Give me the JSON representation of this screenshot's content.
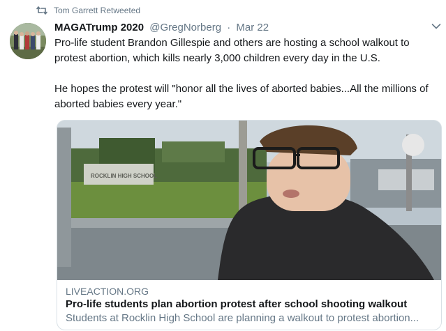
{
  "retweet": {
    "label": "Tom Garrett Retweeted",
    "icon": "retweet-icon"
  },
  "tweet": {
    "author_name": "MAGATrump 2020",
    "handle": "@GregNorberg",
    "separator": "·",
    "date": "Mar 22",
    "paragraphs": [
      "Pro-life student Brandon Gillespie and others are hosting a school walkout to protest abortion, which kills nearly 3,000 children every day in the U.S.",
      "He hopes the protest will \"honor all the lives of aborted babies...All the millions of aborted babies every year.\""
    ],
    "menu_icon": "chevron-down-icon"
  },
  "card": {
    "image_sign_text": "ROCKLIN HIGH SCHOOL",
    "domain": "LIVEACTION.ORG",
    "title": "Pro-life students plan abortion protest after school shooting walkout",
    "description": "Students at Rocklin High School are planning a walkout to protest abortion..."
  },
  "colors": {
    "text_primary": "#14171a",
    "text_secondary": "#657786",
    "card_border": "#d9e1e6"
  }
}
